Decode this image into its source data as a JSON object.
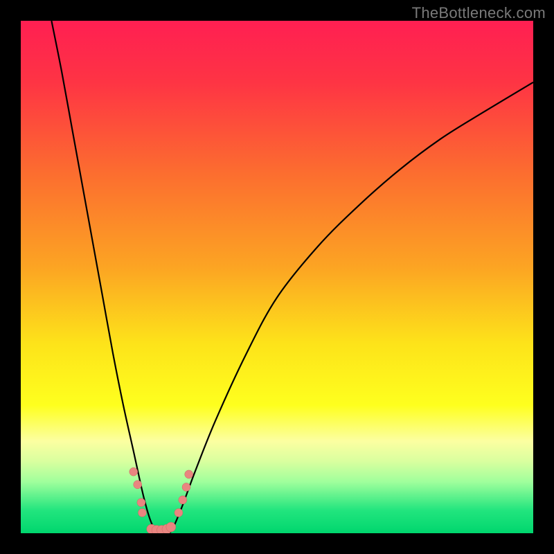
{
  "watermark": "TheBottleneck.com",
  "chart_data": {
    "type": "line",
    "title": "",
    "xlabel": "",
    "ylabel": "",
    "xlim": [
      0,
      100
    ],
    "ylim": [
      0,
      100
    ],
    "background_gradient": {
      "stops": [
        {
          "pos": 0.0,
          "color": "#ff1f52"
        },
        {
          "pos": 0.12,
          "color": "#fe3444"
        },
        {
          "pos": 0.3,
          "color": "#fc6e2f"
        },
        {
          "pos": 0.48,
          "color": "#fca423"
        },
        {
          "pos": 0.63,
          "color": "#fde31a"
        },
        {
          "pos": 0.75,
          "color": "#feff1e"
        },
        {
          "pos": 0.82,
          "color": "#fcffa1"
        },
        {
          "pos": 0.86,
          "color": "#d9ff9f"
        },
        {
          "pos": 0.9,
          "color": "#9fff9c"
        },
        {
          "pos": 0.955,
          "color": "#22e57e"
        },
        {
          "pos": 1.0,
          "color": "#00d66e"
        }
      ]
    },
    "series": [
      {
        "name": "bottleneck-curve",
        "color": "#000000",
        "x": [
          6,
          8,
          10,
          12,
          14,
          16,
          18,
          20,
          22,
          24,
          25.5,
          27,
          29,
          31,
          34,
          38,
          44,
          50,
          58,
          66,
          74,
          82,
          90,
          100
        ],
        "y": [
          100,
          90,
          79,
          68,
          57,
          46,
          35,
          25,
          16,
          7,
          2,
          0,
          0,
          4,
          12,
          22,
          35,
          46,
          56,
          64,
          71,
          77,
          82,
          88
        ]
      }
    ],
    "markers": [
      {
        "name": "left-cluster",
        "x": [
          22.0,
          22.8,
          23.5,
          23.7
        ],
        "y": [
          12.0,
          9.5,
          6.0,
          4.0
        ],
        "color": "#e98580",
        "size": 6
      },
      {
        "name": "right-cluster",
        "x": [
          30.8,
          31.6,
          32.3,
          32.8
        ],
        "y": [
          4.0,
          6.5,
          9.0,
          11.5
        ],
        "color": "#e98580",
        "size": 6
      },
      {
        "name": "bottom-cluster",
        "x": [
          25.5,
          26.5,
          27.5,
          28.5,
          29.3
        ],
        "y": [
          0.8,
          0.6,
          0.6,
          0.8,
          1.2
        ],
        "color": "#e98580",
        "size": 7
      }
    ]
  }
}
